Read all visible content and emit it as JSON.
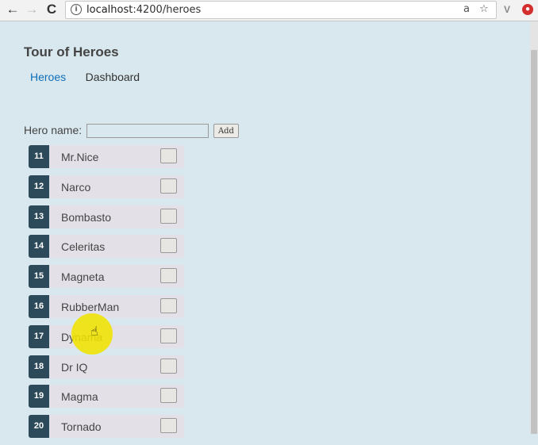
{
  "browser": {
    "back_icon": "←",
    "forward_icon": "→",
    "reload_icon": "C",
    "url_prefix": "localhost",
    "url_path": ":4200/heroes",
    "translate_icon": "a",
    "bookmark_icon": "☆"
  },
  "app": {
    "title": "Tour of Heroes",
    "nav": [
      "Heroes",
      "Dashboard"
    ],
    "form": {
      "label": "Hero name:",
      "input_value": "",
      "add_label": "Add"
    },
    "heroes": [
      {
        "id": "11",
        "name": "Mr.Nice"
      },
      {
        "id": "12",
        "name": "Narco"
      },
      {
        "id": "13",
        "name": "Bombasto"
      },
      {
        "id": "14",
        "name": "Celeritas"
      },
      {
        "id": "15",
        "name": "Magneta"
      },
      {
        "id": "16",
        "name": "RubberMan"
      },
      {
        "id": "17",
        "name": "Dynama"
      },
      {
        "id": "18",
        "name": "Dr IQ"
      },
      {
        "id": "19",
        "name": "Magma"
      },
      {
        "id": "20",
        "name": "Tornado"
      }
    ]
  },
  "colors": {
    "background": "#d9e8ee",
    "badge": "#2d4a5b",
    "active_link": "#0f6eb8",
    "cursor_highlight": "#f0e200"
  }
}
